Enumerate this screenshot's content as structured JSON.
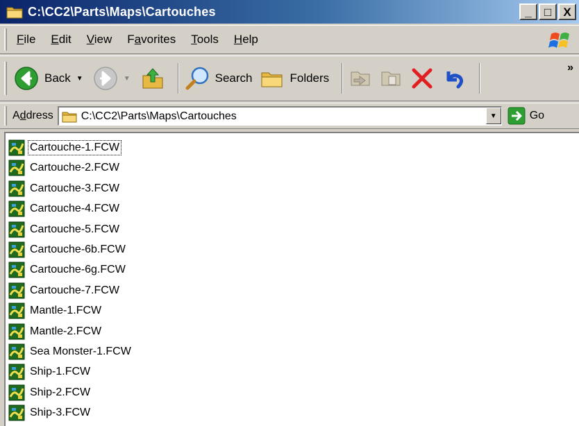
{
  "window": {
    "title": "C:\\CC2\\Parts\\Maps\\Cartouches"
  },
  "title_buttons": [
    "_",
    "□",
    "X"
  ],
  "menu": [
    {
      "key": "F",
      "rest": "ile"
    },
    {
      "key": "E",
      "rest": "dit"
    },
    {
      "key": "V",
      "rest": "iew"
    },
    {
      "pre": "F",
      "key": "a",
      "rest": "vorites"
    },
    {
      "key": "T",
      "rest": "ools"
    },
    {
      "key": "H",
      "rest": "elp"
    }
  ],
  "toolbar": {
    "back_label": "Back",
    "search_label": "Search",
    "folders_label": "Folders",
    "more_chevron": "»"
  },
  "address": {
    "label_pre": "A",
    "label_key": "d",
    "label_rest": "dress",
    "value": "C:\\CC2\\Parts\\Maps\\Cartouches",
    "go_label": "Go"
  },
  "files": [
    "Cartouche-1.FCW",
    "Cartouche-2.FCW",
    "Cartouche-3.FCW",
    "Cartouche-4.FCW",
    "Cartouche-5.FCW",
    "Cartouche-6b.FCW",
    "Cartouche-6g.FCW",
    "Cartouche-7.FCW",
    "Mantle-1.FCW",
    "Mantle-2.FCW",
    "Sea Monster-1.FCW",
    "Ship-1.FCW",
    "Ship-2.FCW",
    "Ship-3.FCW"
  ],
  "colors": {
    "title_start": "#0a246a",
    "title_end": "#a6caf0",
    "face": "#d4d0c8",
    "back_green": "#2e9e32",
    "delete_red": "#e02020",
    "undo_blue": "#1e50c8"
  }
}
